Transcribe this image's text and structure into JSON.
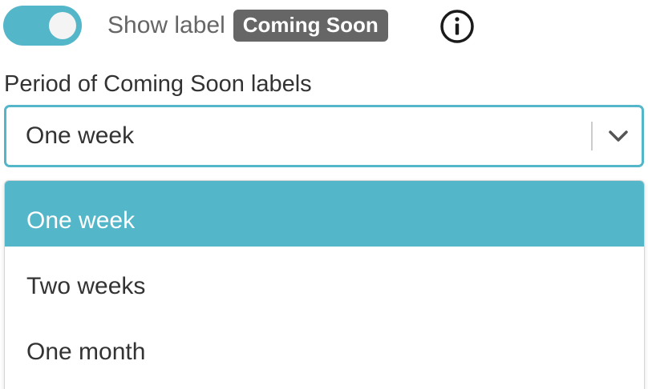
{
  "toggle": {
    "on": true,
    "label": "Show label",
    "badge": "Coming Soon"
  },
  "info_icon": "info-circle-icon",
  "period": {
    "label": "Period of Coming Soon labels",
    "selected": "One week",
    "chevron_icon": "chevron-down-icon",
    "options": [
      "One week",
      "Two weeks",
      "One month"
    ]
  },
  "colors": {
    "accent": "#53b6c9",
    "badge_bg": "#666666",
    "text": "#333333",
    "muted_text": "#666666"
  }
}
